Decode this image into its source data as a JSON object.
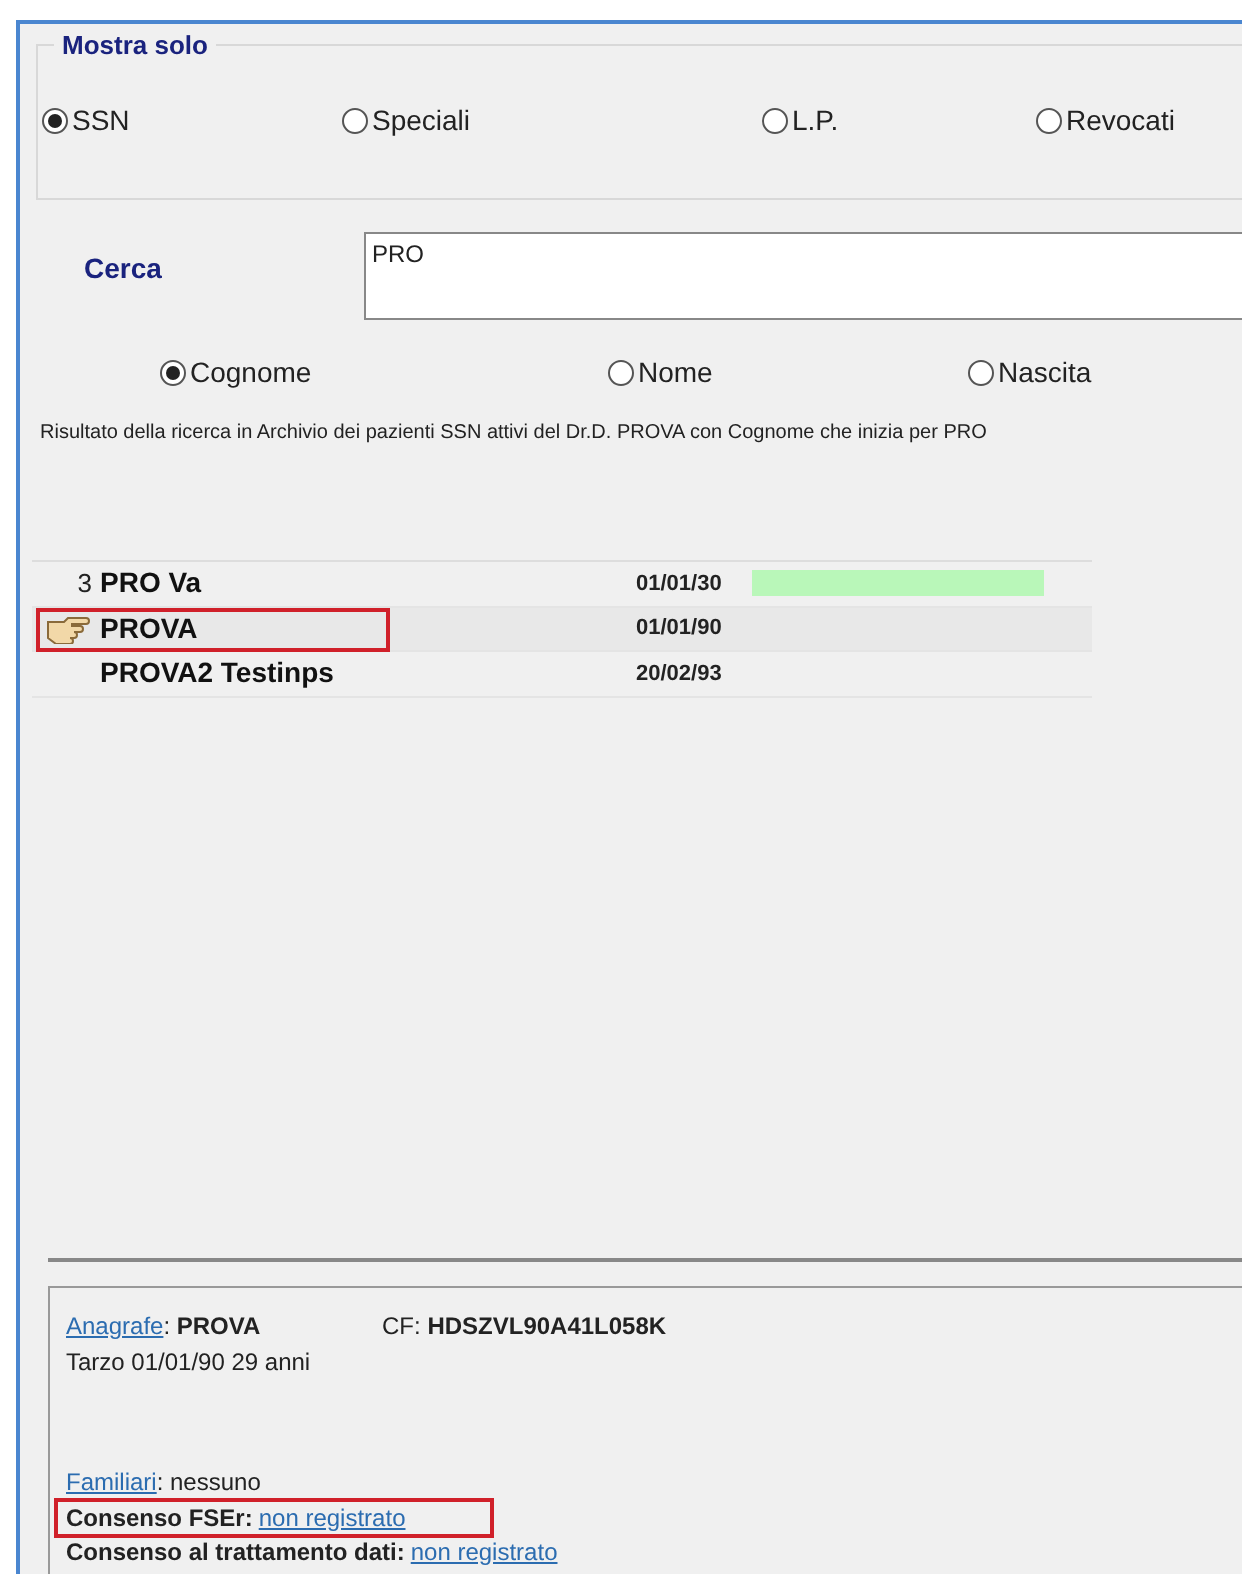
{
  "filter": {
    "title": "Mostra solo",
    "options": [
      {
        "label": "SSN",
        "selected": true
      },
      {
        "label": "Speciali",
        "selected": false
      },
      {
        "label": "L.P.",
        "selected": false
      },
      {
        "label": "Revocati",
        "selected": false
      }
    ]
  },
  "search": {
    "label": "Cerca",
    "value": "PRO",
    "fields": [
      {
        "label": "Cognome",
        "selected": true
      },
      {
        "label": "Nome",
        "selected": false
      },
      {
        "label": "Nascita",
        "selected": false
      }
    ]
  },
  "result_text": "Risultato della ricerca in Archivio dei pazienti SSN attivi del Dr.D. PROVA con Cognome che inizia per PRO",
  "patients": [
    {
      "count": "3",
      "name": "PRO Va",
      "birth": "01/01/30",
      "color": "#b9f7b9",
      "selected": false,
      "annotated": false
    },
    {
      "name": "PROVA",
      "birth": "01/01/90",
      "selected": true,
      "annotated": true
    },
    {
      "name": "PROVA2 Testinps",
      "birth": "20/02/93",
      "selected": false,
      "annotated": false
    }
  ],
  "details": {
    "anagrafe_link": "Anagrafe",
    "anagrafe_sep": ":",
    "name": "PROVA",
    "cf_label": "CF:",
    "cf": "HDSZVL90A41L058K",
    "birth_line": "Tarzo 01/01/90 29 anni",
    "familiari_link": "Familiari",
    "familiari_value": ": nessuno",
    "consents": [
      {
        "label": "Consenso FSEr:",
        "value": "non registrato",
        "annotated": true
      },
      {
        "label": "Consenso al trattamento dati:",
        "value": "non registrato",
        "annotated": false
      }
    ]
  }
}
